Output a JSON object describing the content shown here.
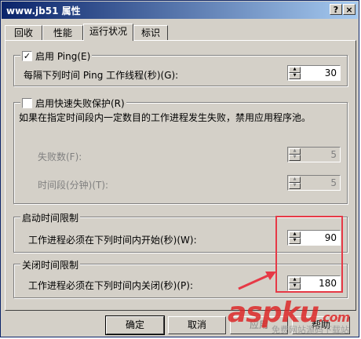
{
  "window": {
    "title": "www.jb51 属性",
    "help_btn": "?",
    "close_btn": "×"
  },
  "tabs": [
    "回收",
    "性能",
    "运行状况",
    "标识"
  ],
  "ping": {
    "label": "启用 Ping(E)",
    "checked": true,
    "interval_label": "每隔下列时间 Ping 工作线程(秒)(G):",
    "interval_value": "30"
  },
  "rapid_fail": {
    "label": "启用快速失败保护(R)",
    "checked": false,
    "description": "如果在指定时间段内一定数目的工作进程发生失败，禁用应用程序池。",
    "failures_label": "失败数(F):",
    "failures_value": "5",
    "period_label": "时间段(分钟)(T):",
    "period_value": "5"
  },
  "startup": {
    "title": "启动时间限制",
    "label": "工作进程必须在下列时间内开始(秒)(W):",
    "value": "90"
  },
  "shutdown": {
    "title": "关闭时间限制",
    "label": "工作进程必须在下列时间内关闭(秒)(P):",
    "value": "180"
  },
  "buttons": {
    "ok": "确定",
    "cancel": "取消",
    "apply": "应用",
    "help": "帮助"
  },
  "watermark": {
    "brand": "aspku",
    "brand_suffix": ".com",
    "tagline": "免费网站源码下载站"
  },
  "colors": {
    "highlight": "#e63946",
    "titlebar": "#0a246a"
  }
}
